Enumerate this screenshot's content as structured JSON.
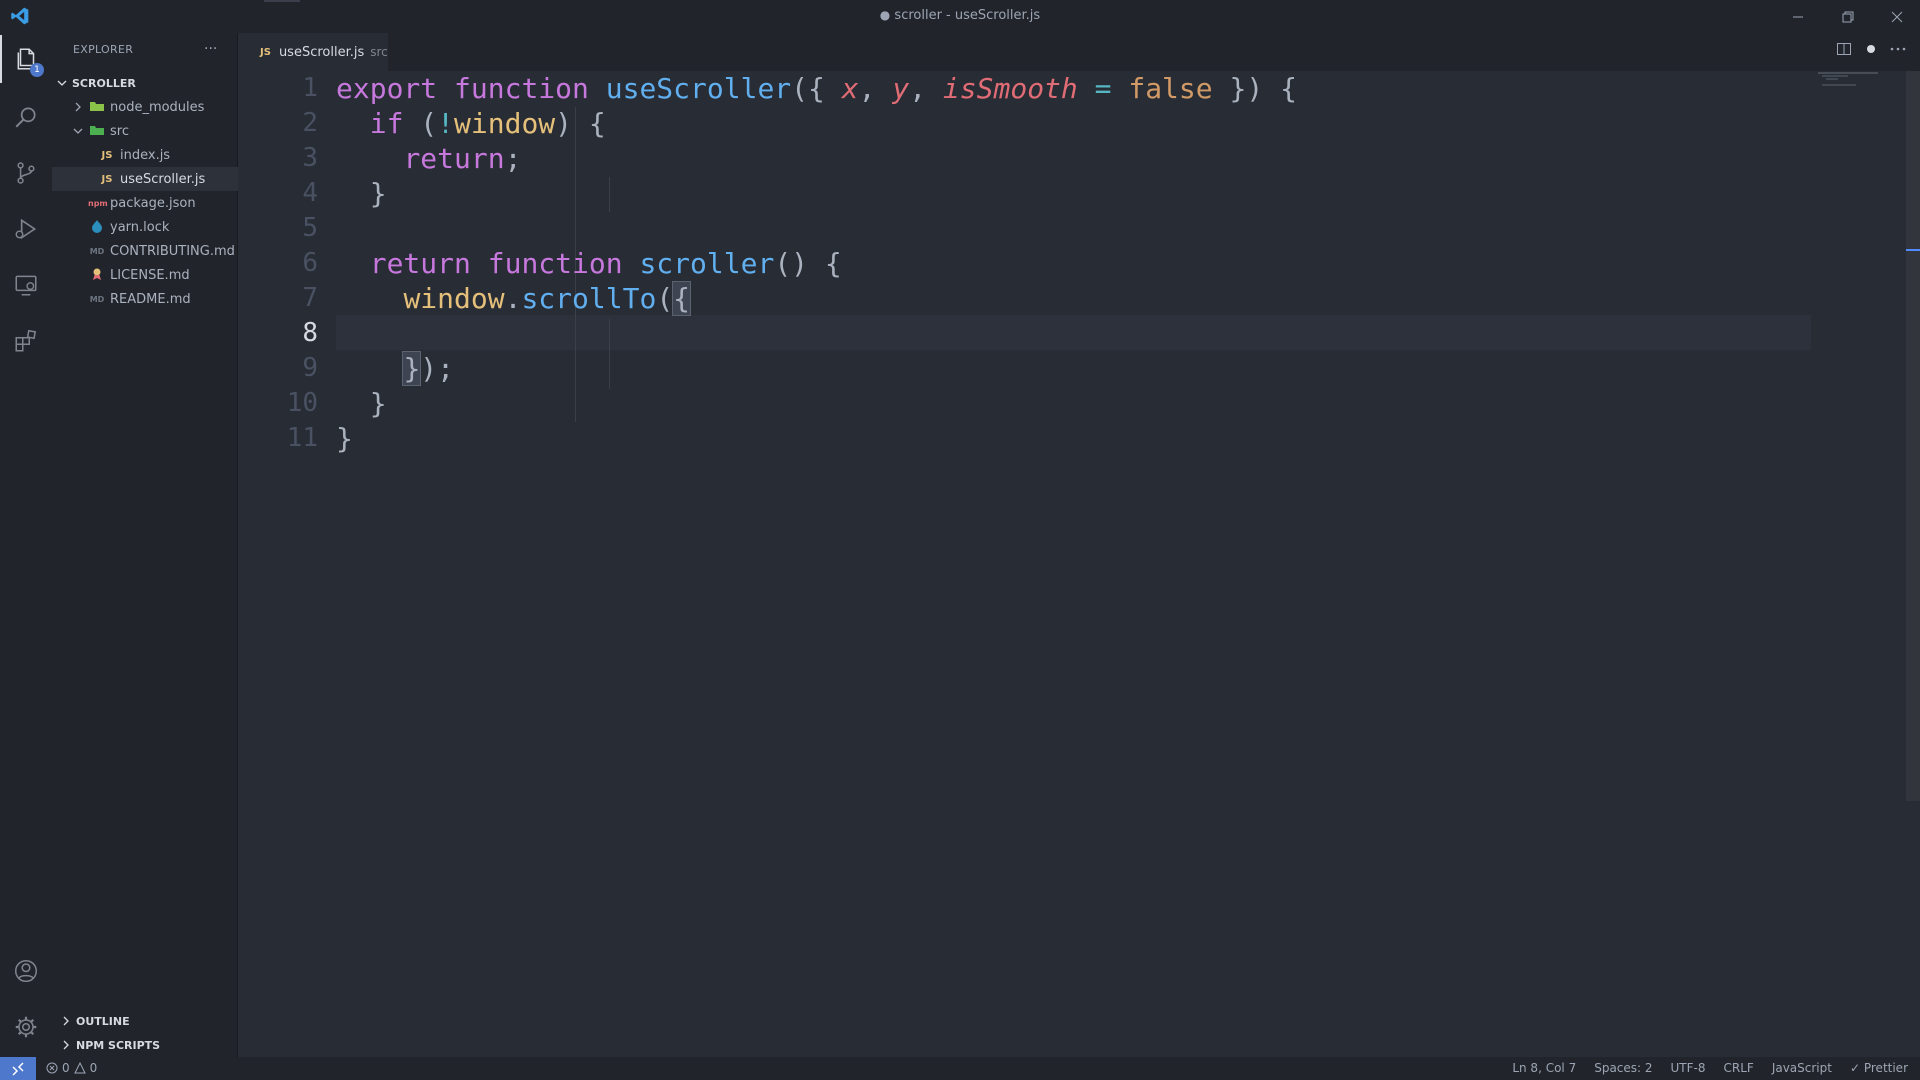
{
  "window": {
    "title_dot": "●",
    "title": "scroller - useScroller.js"
  },
  "activity_bar": {
    "explorer_badge": "1"
  },
  "sidebar": {
    "header": "EXPLORER",
    "more": "···",
    "root": "SCROLLER",
    "items": [
      {
        "label": "node_modules",
        "type": "folder"
      },
      {
        "label": "src",
        "type": "folder-open"
      },
      {
        "label": "index.js",
        "type": "js"
      },
      {
        "label": "useScroller.js",
        "type": "js"
      },
      {
        "label": "package.json",
        "type": "json"
      },
      {
        "label": "yarn.lock",
        "type": "yarn"
      },
      {
        "label": "CONTRIBUTING.md",
        "type": "md"
      },
      {
        "label": "LICENSE.md",
        "type": "license"
      },
      {
        "label": "README.md",
        "type": "md"
      }
    ],
    "outline": "OUTLINE",
    "npm_scripts": "NPM SCRIPTS"
  },
  "tab": {
    "icon": "JS",
    "label": "useScroller.js",
    "description": "src"
  },
  "editor": {
    "line_numbers": [
      "1",
      "2",
      "3",
      "4",
      "5",
      "6",
      "7",
      "8",
      "9",
      "10",
      "11"
    ],
    "tokens": {
      "l1": [
        "export",
        "function",
        "useScroller",
        "({",
        "x",
        ",",
        "y",
        ",",
        "isSmooth",
        "=",
        "false",
        "})",
        "{"
      ],
      "l2": [
        "if",
        "(",
        "!",
        "window",
        ")",
        "{"
      ],
      "l3": [
        "return",
        ";"
      ],
      "l4": [
        "}"
      ],
      "l6": [
        "return",
        "function",
        "scroller",
        "()",
        "{"
      ],
      "l7": [
        "window",
        ".",
        "scrollTo",
        "(",
        "{"
      ],
      "l9": [
        "}",
        ");"
      ],
      "l10": [
        "}"
      ],
      "l11": [
        "}"
      ]
    }
  },
  "statusbar": {
    "errors": "0",
    "warnings": "0",
    "position": "Ln 8, Col 7",
    "spaces": "Spaces: 2",
    "encoding": "UTF-8",
    "eol": "CRLF",
    "language": "JavaScript",
    "formatter": "Prettier"
  }
}
